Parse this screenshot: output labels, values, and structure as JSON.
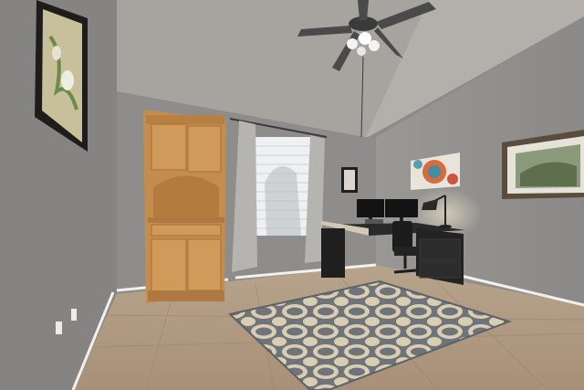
{
  "photo": {
    "kind": "interior-room-photo",
    "room": "home office",
    "colors": {
      "wall": "#908e8d",
      "ceiling": "#a6a39f",
      "floor": "#b39d86",
      "cabinet_wood": "#c9924f",
      "rug_gray": "#6f7479",
      "rug_cream": "#d9cdb3",
      "desk_black": "#232324",
      "curtain": "#b4b3b0"
    },
    "objects": [
      "ceiling-fan",
      "window",
      "curtains",
      "wood-hutch-cabinet",
      "corner-desk",
      "two-monitors",
      "desk-lamp",
      "office-chair",
      "area-rug",
      "framed-botanical-art",
      "framed-landscape-art",
      "round-pattern-canvas",
      "small-framed-picture",
      "wall-outlets",
      "baseboards",
      "tile-floor"
    ]
  }
}
